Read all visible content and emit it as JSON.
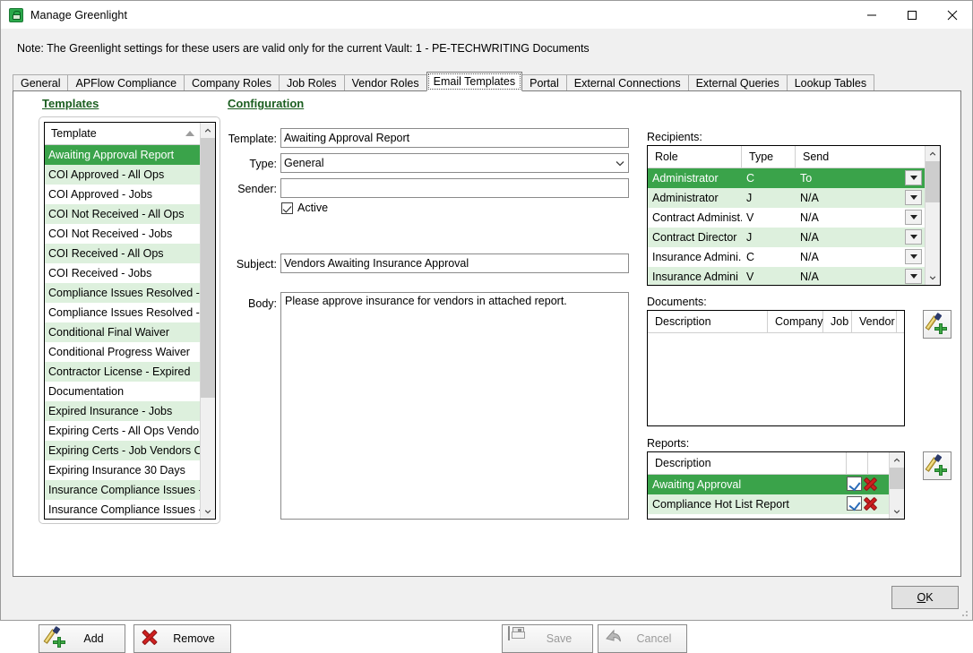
{
  "window": {
    "title": "Manage Greenlight",
    "icon": "greenlight-padlock-icon",
    "minimize": "minimize-icon",
    "maximize": "maximize-icon",
    "close": "close-icon"
  },
  "note": "Note:  The Greenlight settings for these users are valid only for the current Vault: 1 - PE-TECHWRITING Documents",
  "tabs": [
    {
      "label": "General",
      "active": false
    },
    {
      "label": "APFlow Compliance",
      "active": false
    },
    {
      "label": "Company Roles",
      "active": false
    },
    {
      "label": "Job Roles",
      "active": false
    },
    {
      "label": "Vendor Roles",
      "active": false
    },
    {
      "label": "Email Templates",
      "active": true
    },
    {
      "label": "Portal",
      "active": false
    },
    {
      "label": "External Connections",
      "active": false
    },
    {
      "label": "External Queries",
      "active": false
    },
    {
      "label": "Lookup Tables",
      "active": false
    }
  ],
  "templates_panel": {
    "heading": "Templates",
    "column_header": "Template",
    "sort_indicator": "sort-ascending-icon",
    "items": [
      {
        "label": "Awaiting Approval Report",
        "selected": true
      },
      {
        "label": "COI Approved - All Ops",
        "selected": false
      },
      {
        "label": "COI Approved - Jobs",
        "selected": false
      },
      {
        "label": "COI Not Received - All Ops",
        "selected": false
      },
      {
        "label": "COI Not Received - Jobs",
        "selected": false
      },
      {
        "label": "COI Received - All Ops",
        "selected": false
      },
      {
        "label": "COI Received - Jobs",
        "selected": false
      },
      {
        "label": "Compliance Issues Resolved - ...",
        "selected": false
      },
      {
        "label": "Compliance Issues Resolved - J...",
        "selected": false
      },
      {
        "label": "Conditional Final Waiver",
        "selected": false
      },
      {
        "label": "Conditional Progress Waiver",
        "selected": false
      },
      {
        "label": "Contractor License - Expired",
        "selected": false
      },
      {
        "label": "Documentation",
        "selected": false
      },
      {
        "label": "Expired Insurance - Jobs",
        "selected": false
      },
      {
        "label": "Expiring Certs - All Ops Vendor",
        "selected": false
      },
      {
        "label": "Expiring Certs - Job Vendors Only",
        "selected": false
      },
      {
        "label": "Expiring Insurance 30 Days",
        "selected": false
      },
      {
        "label": "Insurance Compliance Issues - ...",
        "selected": false
      },
      {
        "label": "Insurance Compliance Issues - ...",
        "selected": false
      }
    ],
    "add_button": "Add",
    "remove_button": "Remove",
    "add_icon": "pen-add-icon",
    "remove_icon": "red-x-icon"
  },
  "configuration": {
    "heading": "Configuration",
    "labels": {
      "template": "Template:",
      "type": "Type:",
      "sender": "Sender:",
      "subject": "Subject:",
      "body": "Body:"
    },
    "template_value": "Awaiting Approval Report",
    "type_value": "General",
    "type_arrow": "chevron-down-icon",
    "sender_value": "",
    "sender_placeholder": "",
    "active_checked": true,
    "active_label": "Active",
    "subject_value": "Vendors Awaiting Insurance Approval",
    "body_value": "Please approve insurance for vendors in attached report."
  },
  "recipients": {
    "label": "Recipients:",
    "columns": [
      "Role",
      "Type",
      "Send"
    ],
    "rows": [
      {
        "role": "Administrator",
        "type": "C",
        "send": "To",
        "selected": true
      },
      {
        "role": "Administrator",
        "type": "J",
        "send": "N/A",
        "selected": false
      },
      {
        "role": "Contract Administ...",
        "type": "V",
        "send": "N/A",
        "selected": false
      },
      {
        "role": "Contract Director",
        "type": "J",
        "send": "N/A",
        "selected": false
      },
      {
        "role": "Insurance Admini...",
        "type": "C",
        "send": "N/A",
        "selected": false
      },
      {
        "role": "Insurance Admini",
        "type": "V",
        "send": "N/A",
        "selected": false
      }
    ],
    "row_dropdown_icon": "dropdown-arrow-icon"
  },
  "documents": {
    "label": "Documents:",
    "columns": [
      "Description",
      "Company",
      "Job",
      "Vendor"
    ],
    "rows": [],
    "add_icon": "pen-add-icon"
  },
  "reports": {
    "label": "Reports:",
    "columns": [
      "Description"
    ],
    "rows": [
      {
        "description": "Awaiting Approval",
        "selected": true,
        "edit_icon": "edit-icon",
        "delete_icon": "delete-icon"
      },
      {
        "description": "Compliance Hot List Report",
        "selected": false,
        "edit_icon": "edit-icon",
        "delete_icon": "delete-icon"
      }
    ],
    "add_icon": "pen-add-icon"
  },
  "footer": {
    "save_label": "Save",
    "save_icon": "floppy-save-icon",
    "save_enabled": false,
    "cancel_label": "Cancel",
    "cancel_icon": "undo-arrow-icon",
    "cancel_enabled": false,
    "ok_label_prefix": "O",
    "ok_label_suffix": "K"
  },
  "colors": {
    "selection_green": "#3aa34a",
    "alt_row_green": "#ddf0dd",
    "heading_green": "#1b5e20",
    "window_bg": "#f0f0f0"
  }
}
